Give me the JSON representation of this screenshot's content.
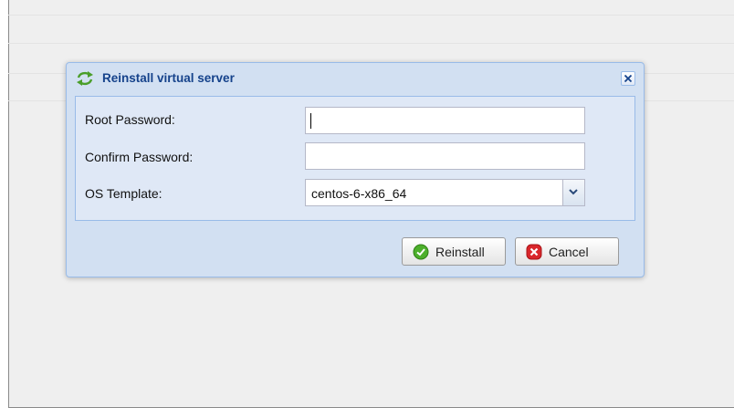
{
  "dialog": {
    "title": "Reinstall virtual server",
    "icons": {
      "title": "refresh-icon",
      "close": "close-icon"
    }
  },
  "form": {
    "root_password": {
      "label": "Root Password:",
      "value": ""
    },
    "confirm_password": {
      "label": "Confirm Password:",
      "value": ""
    },
    "os_template": {
      "label": "OS Template:",
      "value": "centos-6-x86_64"
    }
  },
  "buttons": {
    "reinstall": {
      "label": "Reinstall",
      "icon": "check-circle-icon"
    },
    "cancel": {
      "label": "Cancel",
      "icon": "x-circle-icon"
    }
  },
  "colors": {
    "title_text": "#15428b",
    "dialog_bg": "#d2e0f2",
    "panel_bg": "#dfe8f6",
    "border": "#99bbe8",
    "ok_green": "#4caf2b",
    "cancel_red": "#d9262b"
  }
}
